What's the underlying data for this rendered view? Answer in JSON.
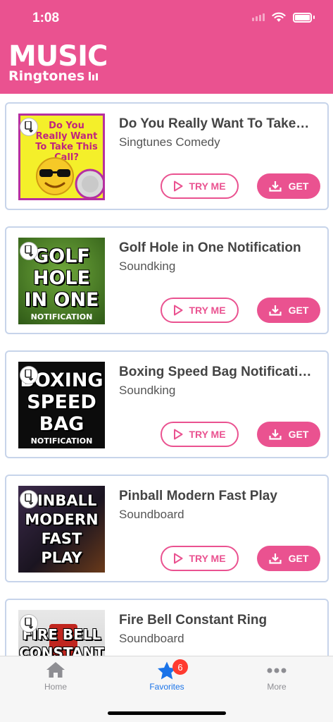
{
  "status_bar": {
    "time": "1:08"
  },
  "app": {
    "logo_main": "MUSIC",
    "logo_sub": "Ringtones"
  },
  "items": [
    {
      "title": "Do You Really Want To Take This Call?",
      "artist": "Singtunes Comedy",
      "art_text": "Do You Really Want To Take This Call?",
      "art_icon": "emoji-sunglasses-icon"
    },
    {
      "title": "Golf Hole in One Notification",
      "artist": "Soundking",
      "art_text": "GOLF HOLE IN ONE",
      "art_sub": "NOTIFICATION"
    },
    {
      "title": "Boxing Speed Bag Notification",
      "artist": "Soundking",
      "art_text": "BOXING SPEED BAG",
      "art_sub": "NOTIFICATION"
    },
    {
      "title": "Pinball Modern Fast Play",
      "artist": "Soundboard",
      "art_text": "PINBALL MODERN FAST PLAY"
    },
    {
      "title": "Fire Bell Constant Ring",
      "artist": "Soundboard",
      "art_text": "FIRE BELL CONSTANT"
    }
  ],
  "buttons": {
    "try": "TRY ME",
    "get": "GET"
  },
  "tabs": [
    {
      "label": "Home",
      "icon": "house-icon"
    },
    {
      "label": "Favorites",
      "icon": "star-icon",
      "badge": "6"
    },
    {
      "label": "More",
      "icon": "more-dots-icon"
    }
  ],
  "colors": {
    "brand": "#ea5290",
    "tab_active": "#1a73e8",
    "badge": "#ff3b30"
  }
}
